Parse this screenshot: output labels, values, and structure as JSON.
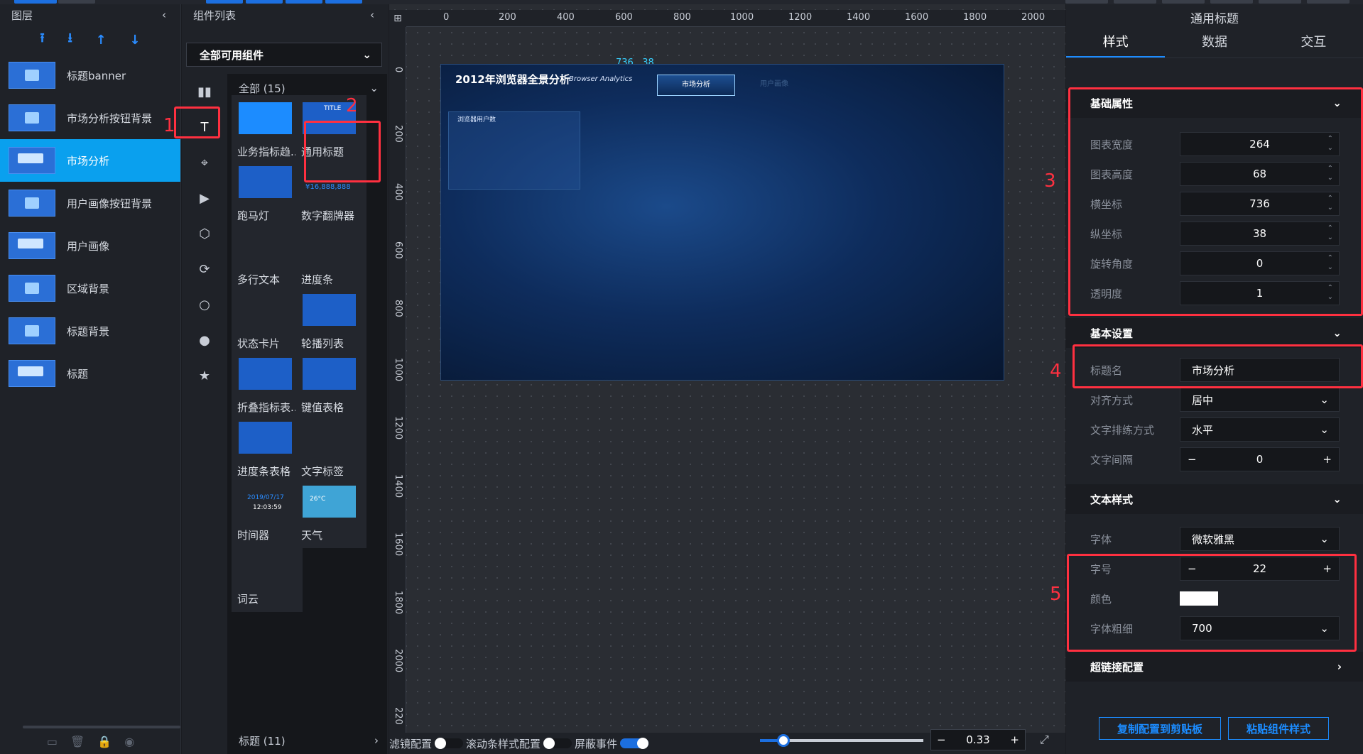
{
  "layers": {
    "title": "图层",
    "tools": [
      "⭱",
      "⭳",
      "↑",
      "↓"
    ],
    "items": [
      {
        "label": "标题banner",
        "thumb": "image"
      },
      {
        "label": "市场分析按钮背景",
        "thumb": "image"
      },
      {
        "label": "市场分析",
        "thumb": "title",
        "selected": true
      },
      {
        "label": "用户画像按钮背景",
        "thumb": "image"
      },
      {
        "label": "用户画像",
        "thumb": "title"
      },
      {
        "label": "区域背景",
        "thumb": "image"
      },
      {
        "label": "标题背景",
        "thumb": "image"
      },
      {
        "label": "标题",
        "thumb": "title"
      }
    ]
  },
  "components": {
    "title": "组件列表",
    "filter": "全部可用组件",
    "group_all": "全部 (15)",
    "group_footer": "标题 (11)",
    "cards": [
      "业务指标趋...",
      "通用标题",
      "跑马灯",
      "数字翻牌器",
      "多行文本",
      "进度条",
      "状态卡片",
      "轮播列表",
      "折叠指标表...",
      "键值表格",
      "进度条表格",
      "文字标签",
      "时间器",
      "天气",
      "词云"
    ],
    "preview_text": {
      "title": "TITLE",
      "flip": "¥16,888,888",
      "date": "2019/07/17",
      "time": "12:03:59",
      "temp": "26°C"
    }
  },
  "canvas": {
    "ruler_h": [
      "0",
      "200",
      "400",
      "600",
      "800",
      "1000",
      "1200",
      "1400",
      "1600",
      "1800",
      "2000"
    ],
    "ruler_v": [
      "0",
      "200",
      "400",
      "600",
      "800",
      "1000",
      "1200",
      "1400",
      "1600",
      "1800",
      "2000",
      "220"
    ],
    "coord": "736 , 38",
    "screen_title": "2012年浏览器全景分析",
    "screen_sub": "Browser Analytics",
    "tab_active": "市场分析",
    "tab_inactive": "用户画像",
    "box_label": "浏览器用户数",
    "bottom": {
      "filter": "滤镜配置",
      "scroll": "滚动条样式配置",
      "mask": "屏蔽事件",
      "zoom": "0.33",
      "zoom_level": 0.33
    }
  },
  "props": {
    "title": "通用标题",
    "tabs": [
      "样式",
      "数据",
      "交互"
    ],
    "sec_basic": "基础属性",
    "basic": [
      {
        "k": "图表宽度",
        "v": "264"
      },
      {
        "k": "图表高度",
        "v": "68"
      },
      {
        "k": "横坐标",
        "v": "736"
      },
      {
        "k": "纵坐标",
        "v": "38"
      },
      {
        "k": "旋转角度",
        "v": "0"
      },
      {
        "k": "透明度",
        "v": "1"
      }
    ],
    "sec_setting": "基本设置",
    "title_name_k": "标题名",
    "title_name_v": "市场分析",
    "align_k": "对齐方式",
    "align_v": "居中",
    "dir_k": "文字排练方式",
    "dir_v": "水平",
    "gap_k": "文字间隔",
    "gap_v": "0",
    "sec_text": "文本样式",
    "font_k": "字体",
    "font_v": "微软雅黑",
    "size_k": "字号",
    "size_v": "22",
    "color_k": "颜色",
    "color_v": "#ffffff",
    "weight_k": "字体粗细",
    "weight_v": "700",
    "sec_link": "超链接配置",
    "copy_btn": "复制配置到剪贴板",
    "paste_btn": "粘贴组件样式"
  },
  "annotations": [
    "1",
    "2",
    "3",
    "4",
    "5"
  ]
}
